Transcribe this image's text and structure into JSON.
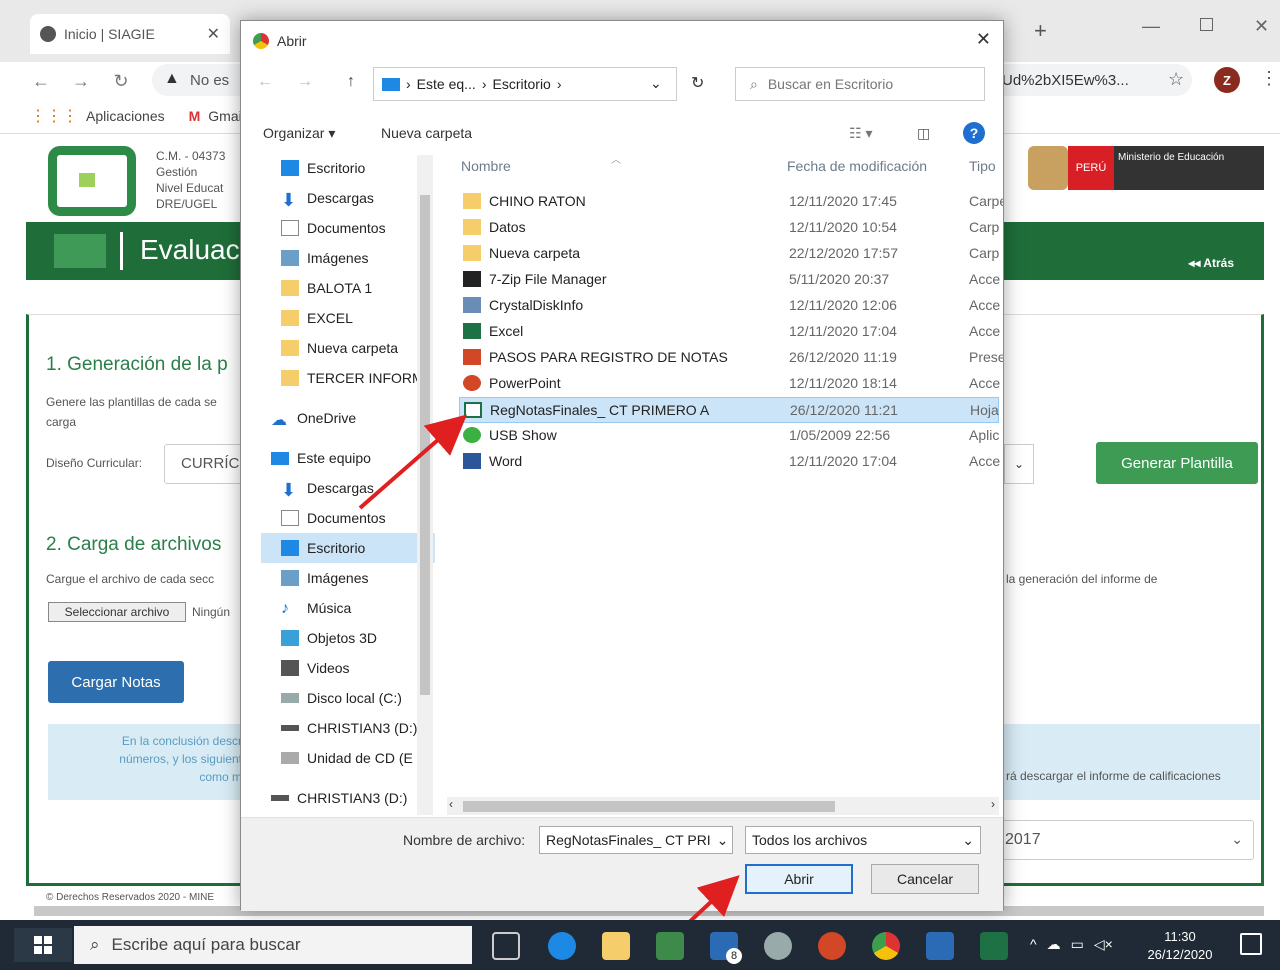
{
  "browser": {
    "tabs": [
      {
        "title": "Inicio | SIAGIE"
      }
    ],
    "address": {
      "prefix": "No es",
      "tail": "Ud%2bXI5Ew%3..."
    },
    "profile_initial": "Z",
    "bookmarks": [
      {
        "label": "Aplicaciones"
      },
      {
        "label": "Gmail"
      }
    ]
  },
  "page": {
    "header_lines": [
      "C.M. - 04373",
      "Gestión",
      "Nivel Educat",
      "DRE/UGEL"
    ],
    "ministry": {
      "peru": "PERÚ",
      "name": "Ministerio de Educación"
    },
    "banner_title": "Evaluac",
    "back_link": "◂◂ Atrás",
    "section1": {
      "title": "1. Generación de la p",
      "desc": "Genere las plantillas de cada se\ncarga",
      "curriculum_label": "Diseño Curricular:",
      "curriculum_value": "CURRÍC",
      "generate_button": "Generar Plantilla"
    },
    "section2": {
      "title": "2. Carga de archivos",
      "desc": "Cargue el archivo de cada secc",
      "desc_tail": "la generación del informe de",
      "select_file": "Seleccionar archivo",
      "no_file": "Ningún",
      "upload_button": "Cargar Notas"
    },
    "notice": {
      "text1": "En la conclusión descr",
      "text2": "números, y los siguient",
      "text3": "como m",
      "tail": "rá descargar el informe de calificaciones"
    },
    "year": "2017",
    "footer_text": "© Derechos Reservados 2020 - MINE"
  },
  "dialog": {
    "title": "Abrir",
    "breadcrumb": [
      "Este eq...",
      "Escritorio"
    ],
    "search_placeholder": "Buscar en Escritorio",
    "organize": "Organizar",
    "new_folder": "Nueva carpeta",
    "nav_items": [
      {
        "label": "Escritorio",
        "pinned": true
      },
      {
        "label": "Descargas",
        "pinned": true
      },
      {
        "label": "Documentos",
        "pinned": true
      },
      {
        "label": "Imágenes",
        "pinned": true
      },
      {
        "label": "BALOTA 1"
      },
      {
        "label": "EXCEL"
      },
      {
        "label": "Nueva carpeta"
      },
      {
        "label": "TERCER INFORM"
      },
      {
        "label": "OneDrive"
      },
      {
        "label": "Este equipo"
      },
      {
        "label": "Descargas"
      },
      {
        "label": "Documentos"
      },
      {
        "label": "Escritorio"
      },
      {
        "label": "Imágenes"
      },
      {
        "label": "Música"
      },
      {
        "label": "Objetos 3D"
      },
      {
        "label": "Videos"
      },
      {
        "label": "Disco local (C:)"
      },
      {
        "label": "CHRISTIAN3 (D:)"
      },
      {
        "label": "Unidad de CD (E"
      },
      {
        "label": "CHRISTIAN3 (D:)"
      }
    ],
    "columns": {
      "name": "Nombre",
      "date": "Fecha de modificación",
      "type": "Tipo"
    },
    "files": [
      {
        "name": "CHINO RATON",
        "date": "12/11/2020 17:45",
        "type": "Carpeta",
        "icon": "folder"
      },
      {
        "name": "Datos",
        "date": "12/11/2020 10:54",
        "type": "Carp",
        "icon": "folder"
      },
      {
        "name": "Nueva carpeta",
        "date": "22/12/2020 17:57",
        "type": "Carp",
        "icon": "folder"
      },
      {
        "name": "7-Zip File Manager",
        "date": "5/11/2020 20:37",
        "type": "Acce",
        "icon": "7zip"
      },
      {
        "name": "CrystalDiskInfo",
        "date": "12/11/2020 12:06",
        "type": "Acce",
        "icon": "crystal"
      },
      {
        "name": "Excel",
        "date": "12/11/2020 17:04",
        "type": "Acce",
        "icon": "excel"
      },
      {
        "name": "PASOS PARA REGISTRO DE NOTAS",
        "date": "26/12/2020 11:19",
        "type": "Prese",
        "icon": "ppt"
      },
      {
        "name": "PowerPoint",
        "date": "12/11/2020 18:14",
        "type": "Acce",
        "icon": "ppt"
      },
      {
        "name": "RegNotasFinales_ CT PRIMERO A",
        "date": "26/12/2020 11:21",
        "type": "Hoja",
        "icon": "excel-sheet"
      },
      {
        "name": "USB Show",
        "date": "1/05/2009 22:56",
        "type": "Aplic",
        "icon": "usb"
      },
      {
        "name": "Word",
        "date": "12/11/2020 17:04",
        "type": "Acce",
        "icon": "word"
      }
    ],
    "filename_label": "Nombre de archivo:",
    "filename_value": "RegNotasFinales_ CT PRI",
    "filter_value": "Todos los archivos",
    "open_button": "Abrir",
    "cancel_button": "Cancelar"
  },
  "taskbar": {
    "search_placeholder": "Escribe aquí para buscar",
    "mail_badge": "8",
    "time": "11:30",
    "date": "26/12/2020"
  },
  "colors": {
    "accent_green": "#1e7a3b",
    "selection": "#cce4f7",
    "arrow": "#e02020",
    "taskbar": "#1f2a36"
  }
}
